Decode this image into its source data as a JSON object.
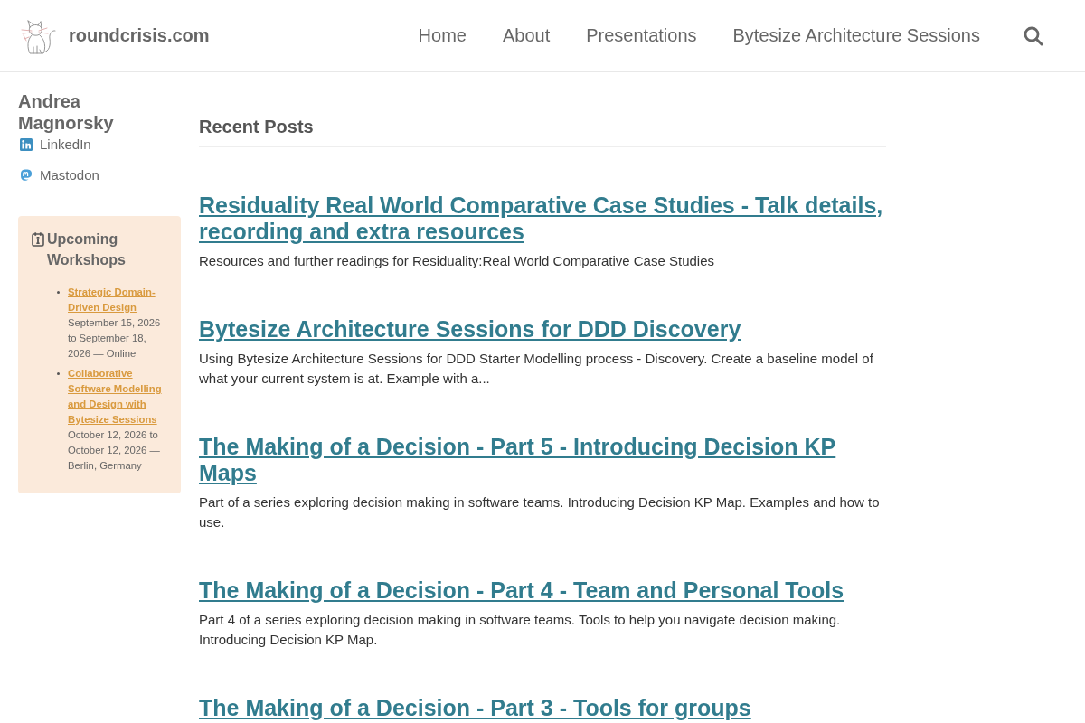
{
  "header": {
    "site_name": "roundcrisis.com",
    "nav": [
      "Home",
      "About",
      "Presentations",
      "Bytesize Architecture Sessions"
    ]
  },
  "sidebar": {
    "author": "Andrea Magnorsky",
    "social_links": [
      {
        "kind": "linkedin",
        "label": "LinkedIn"
      },
      {
        "kind": "mastodon",
        "label": "Mastodon"
      }
    ],
    "workshops": {
      "title": "Upcoming Workshops",
      "items": [
        {
          "title": "Strategic Domain-Driven Design",
          "details": "September 15, 2026 to September 18, 2026 — Online"
        },
        {
          "title": "Collaborative Software Modelling and Design with Bytesize Sessions",
          "details": "October 12, 2026 to October 12, 2026 — Berlin, Germany"
        }
      ]
    }
  },
  "recent_posts": {
    "title": "Recent Posts",
    "posts": [
      {
        "title": "Residuality Real World Comparative Case Studies - Talk details, recording and extra resources",
        "summary": "Resources and further readings for Residuality:Real World Comparative Case Studies"
      },
      {
        "title": "Bytesize Architecture Sessions for DDD Discovery",
        "summary": "Using Bytesize Architecture Sessions for DDD Starter Modelling process - Discovery. Create a baseline model of what your current system is at. Example with a..."
      },
      {
        "title": "The Making of a Decision - Part 5 - Introducing Decision KP Maps",
        "summary": "Part of a series exploring decision making in software teams. Introducing Decision KP Map. Examples and how to use."
      },
      {
        "title": "The Making of a Decision - Part 4 - Team and Personal Tools",
        "summary": "Part 4 of a series exploring decision making in software teams. Tools to help you navigate decision making. Introducing Decision KP Map."
      },
      {
        "title": "The Making of a Decision - Part 3 - Tools for groups"
      }
    ]
  }
}
